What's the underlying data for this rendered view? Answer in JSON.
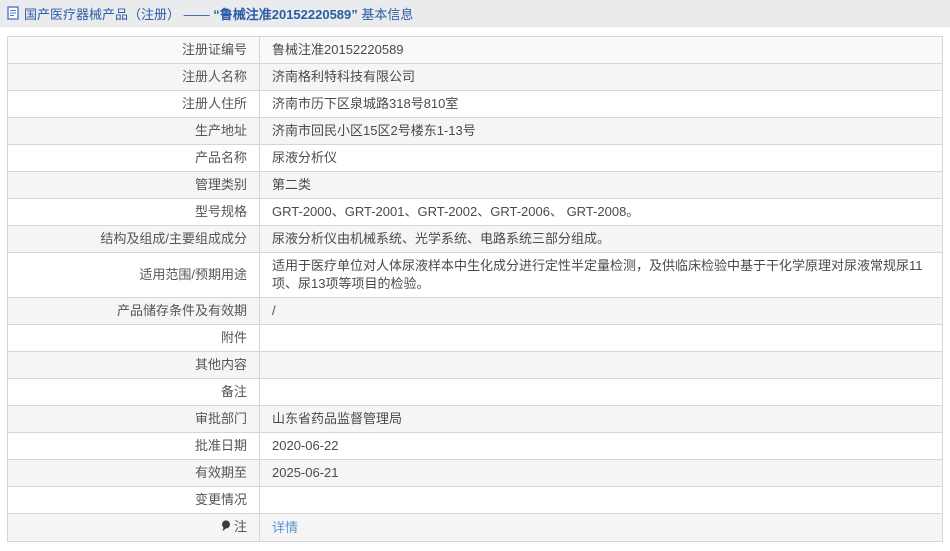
{
  "header": {
    "doc_icon": "document-icon",
    "title_prefix": "国产医疗器械产品（注册） —— ",
    "title_highlight": "“鲁械注准20152220589”",
    "title_suffix": " 基本信息"
  },
  "colors": {
    "header_bg": "#eaebec",
    "title_blue": "#2b5ca8",
    "link_blue": "#5596d6",
    "row_first": "#f8f9fa",
    "row_alt": "#f5f5f5",
    "row_plain": "#ffffff",
    "border": "#d6d6d6",
    "pin_icon": "#3c3c3c"
  },
  "table": {
    "rows": [
      {
        "label": "注册证编号",
        "value": "鲁械注准20152220589"
      },
      {
        "label": "注册人名称",
        "value": "济南格利特科技有限公司"
      },
      {
        "label": "注册人住所",
        "value": "济南市历下区泉城路318号810室"
      },
      {
        "label": "生产地址",
        "value": "济南市回民小区15区2号楼东1-13号"
      },
      {
        "label": "产品名称",
        "value": "尿液分析仪"
      },
      {
        "label": "管理类别",
        "value": "第二类"
      },
      {
        "label": "型号规格",
        "value": "GRT-2000、GRT-2001、GRT-2002、GRT-2006、 GRT-2008。"
      },
      {
        "label": "结构及组成/主要组成成分",
        "value": "尿液分析仪由机械系统、光学系统、电路系统三部分组成。"
      },
      {
        "label": "适用范围/预期用途",
        "value": "适用于医疗单位对人体尿液样本中生化成分进行定性半定量检测，及供临床检验中基于干化学原理对尿液常规尿11项、尿13项等项目的检验。"
      },
      {
        "label": "产品储存条件及有效期",
        "value": "/"
      },
      {
        "label": "附件",
        "value": ""
      },
      {
        "label": "其他内容",
        "value": ""
      },
      {
        "label": "备注",
        "value": ""
      },
      {
        "label": "审批部门",
        "value": "山东省药品监督管理局"
      },
      {
        "label": "批准日期",
        "value": "2020-06-22"
      },
      {
        "label": "有效期至",
        "value": "2025-06-21"
      },
      {
        "label": "变更情况",
        "value": ""
      },
      {
        "label": "注",
        "icon": "note-pin-icon",
        "link": "详情"
      }
    ]
  }
}
